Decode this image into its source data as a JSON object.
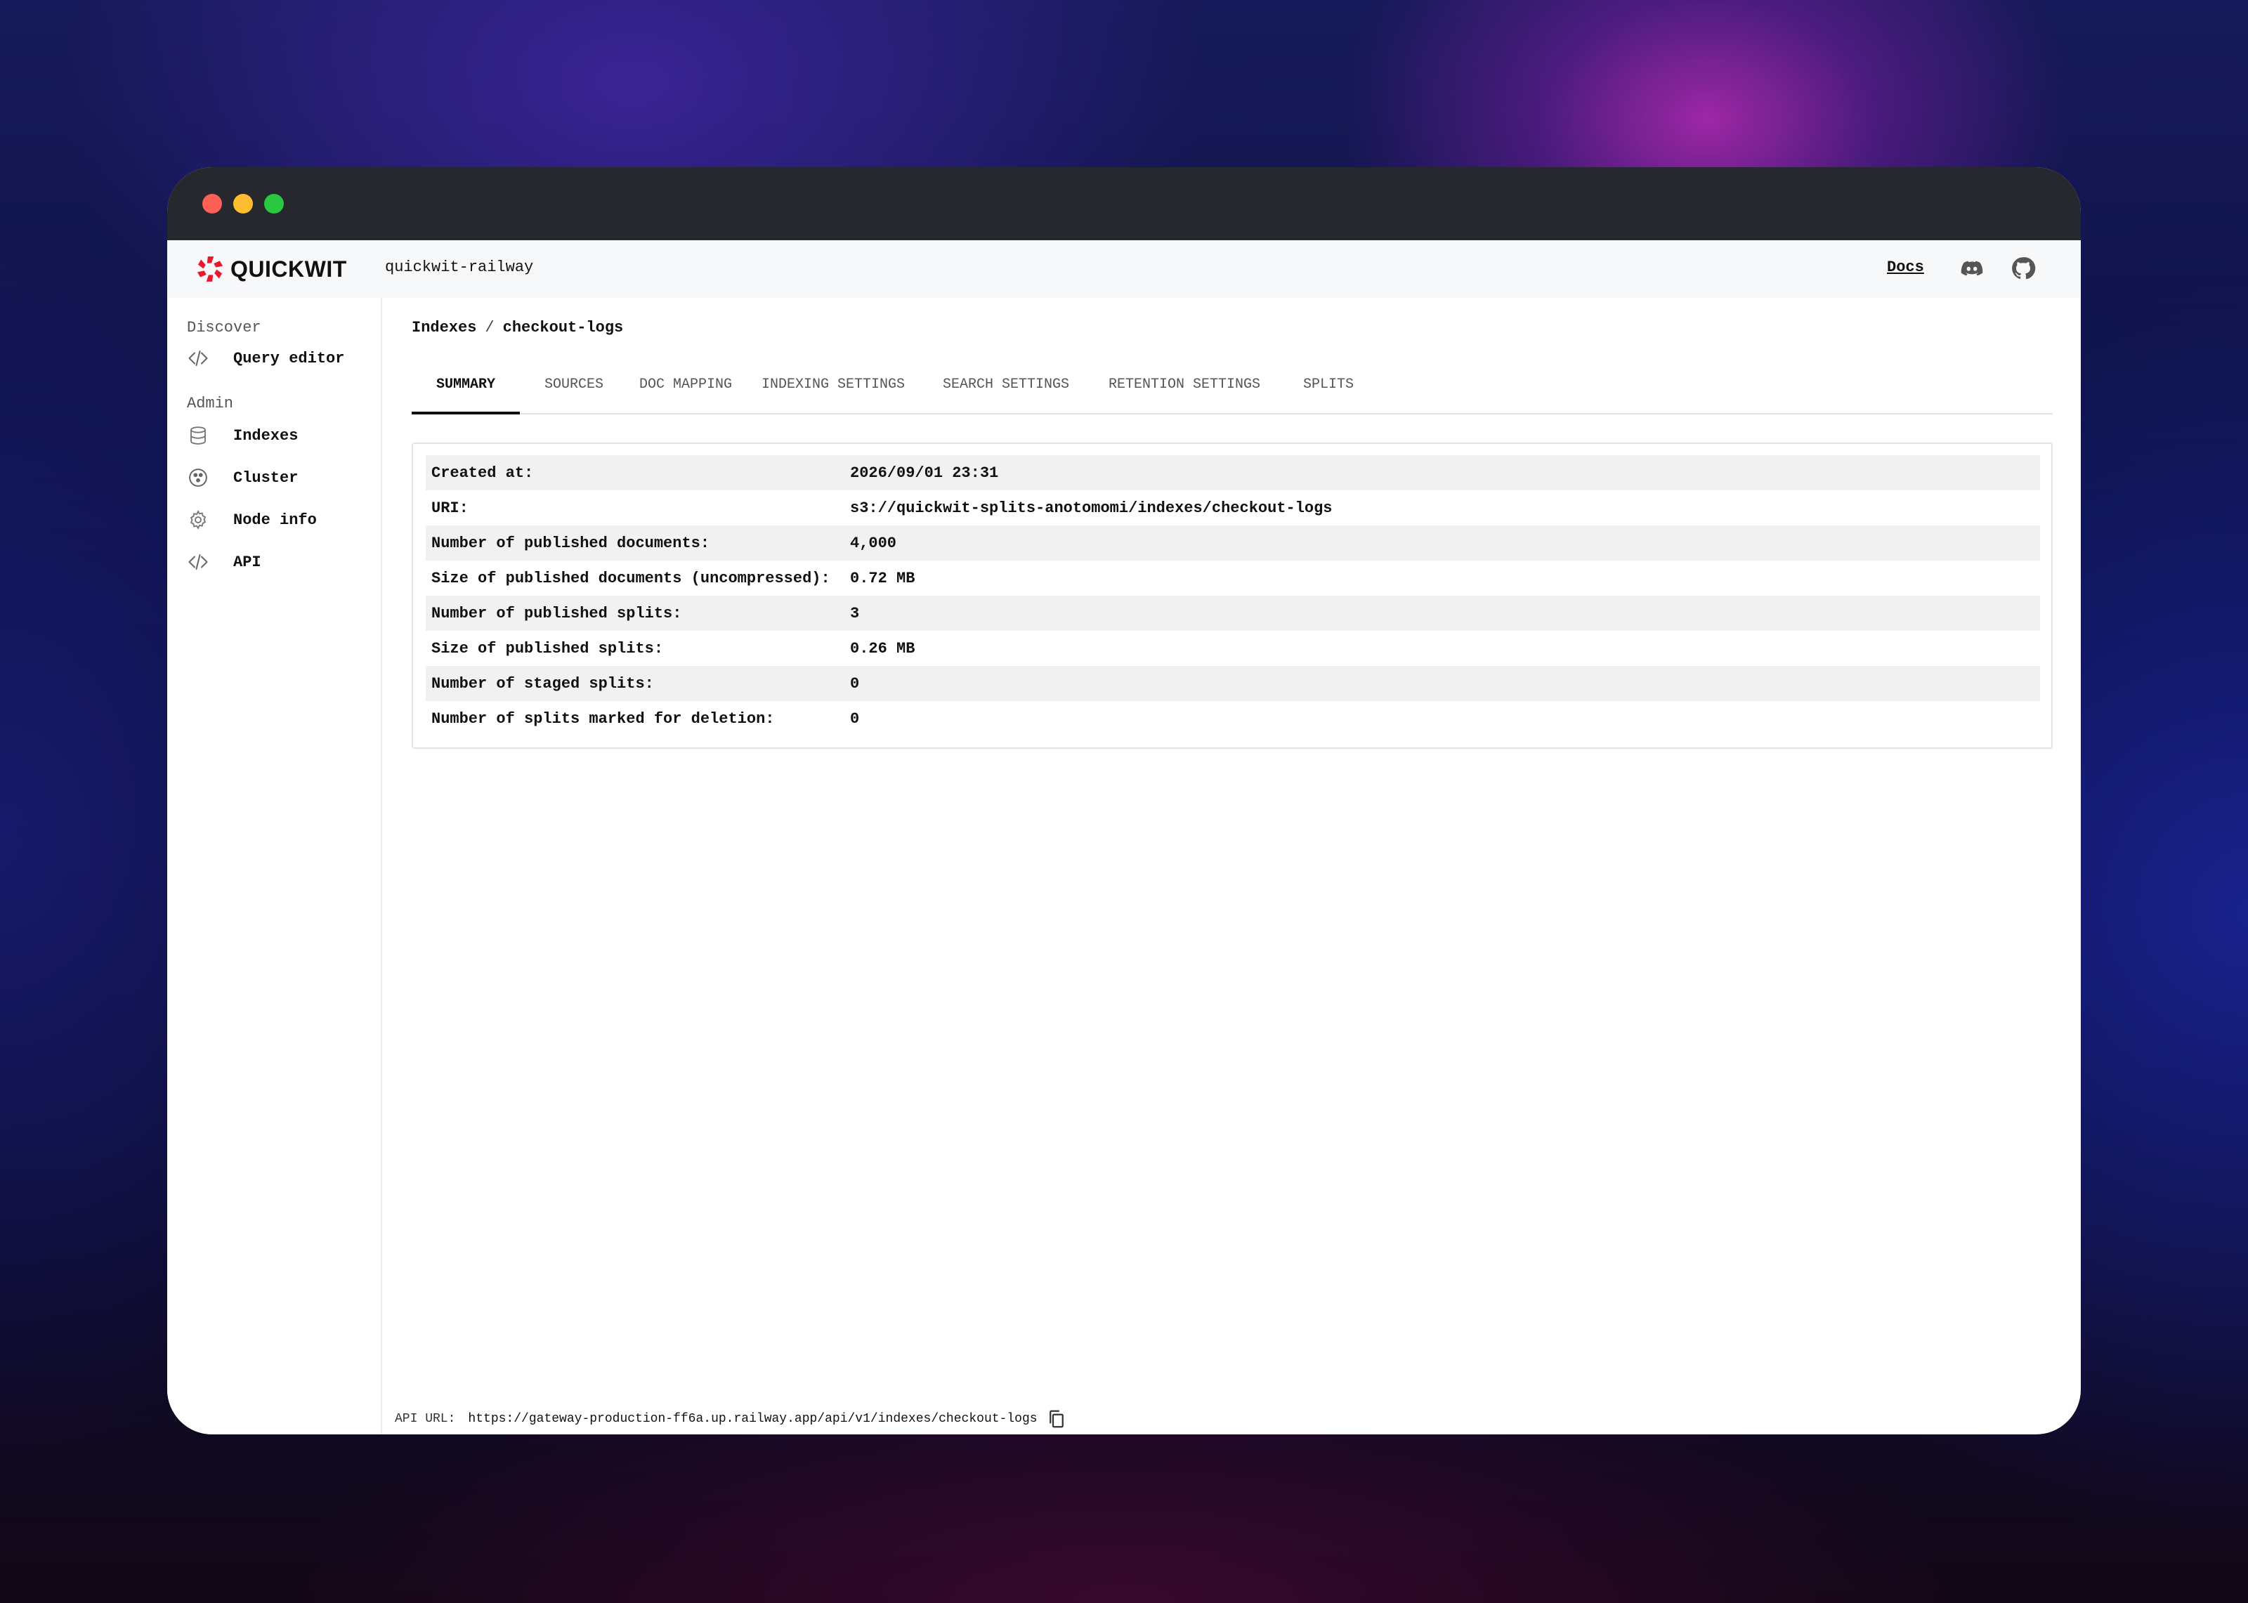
{
  "window": {
    "controls": [
      "close",
      "minimize",
      "maximize"
    ]
  },
  "appbar": {
    "logo_text": "QUICKWIT",
    "cluster_name": "quickwit-railway",
    "docs_label": "Docs",
    "icons": [
      "discord-icon",
      "github-icon"
    ]
  },
  "sidebar": {
    "discover_label": "Discover",
    "admin_label": "Admin",
    "items": [
      {
        "label": "Query editor",
        "icon": "code-icon"
      },
      {
        "label": "Indexes",
        "icon": "database-icon"
      },
      {
        "label": "Cluster",
        "icon": "cluster-icon"
      },
      {
        "label": "Node info",
        "icon": "gear-icon"
      },
      {
        "label": "API",
        "icon": "code-icon"
      }
    ]
  },
  "breadcrumb": {
    "root": "Indexes",
    "separator": "/",
    "current": "checkout-logs"
  },
  "tabs": [
    {
      "label": "SUMMARY",
      "active": true
    },
    {
      "label": "SOURCES",
      "active": false
    },
    {
      "label": "DOC MAPPING",
      "active": false
    },
    {
      "label": "INDEXING SETTINGS",
      "active": false
    },
    {
      "label": "SEARCH SETTINGS",
      "active": false
    },
    {
      "label": "RETENTION SETTINGS",
      "active": false
    },
    {
      "label": "SPLITS",
      "active": false
    }
  ],
  "summary": [
    {
      "key": "Created at:",
      "value": "2026/09/01 23:31"
    },
    {
      "key": "URI:",
      "value": "s3://quickwit-splits-anotomomi/indexes/checkout-logs"
    },
    {
      "key": "Number of published documents:",
      "value": "4,000"
    },
    {
      "key": "Size of published documents (uncompressed):",
      "value": "0.72 MB"
    },
    {
      "key": "Number of published splits:",
      "value": "3"
    },
    {
      "key": "Size of published splits:",
      "value": "0.26 MB"
    },
    {
      "key": "Number of staged splits:",
      "value": "0"
    },
    {
      "key": "Number of splits marked for deletion:",
      "value": "0"
    }
  ],
  "footer": {
    "api_label": "API URL:",
    "api_url": "https://gateway-production-ff6a.up.railway.app/api/v1/indexes/checkout-logs"
  },
  "colors": {
    "brand_red": "#e8192c",
    "titlebar": "#27282d",
    "close": "#fe5f57",
    "minimize": "#febc2e",
    "maximize": "#28c840"
  }
}
